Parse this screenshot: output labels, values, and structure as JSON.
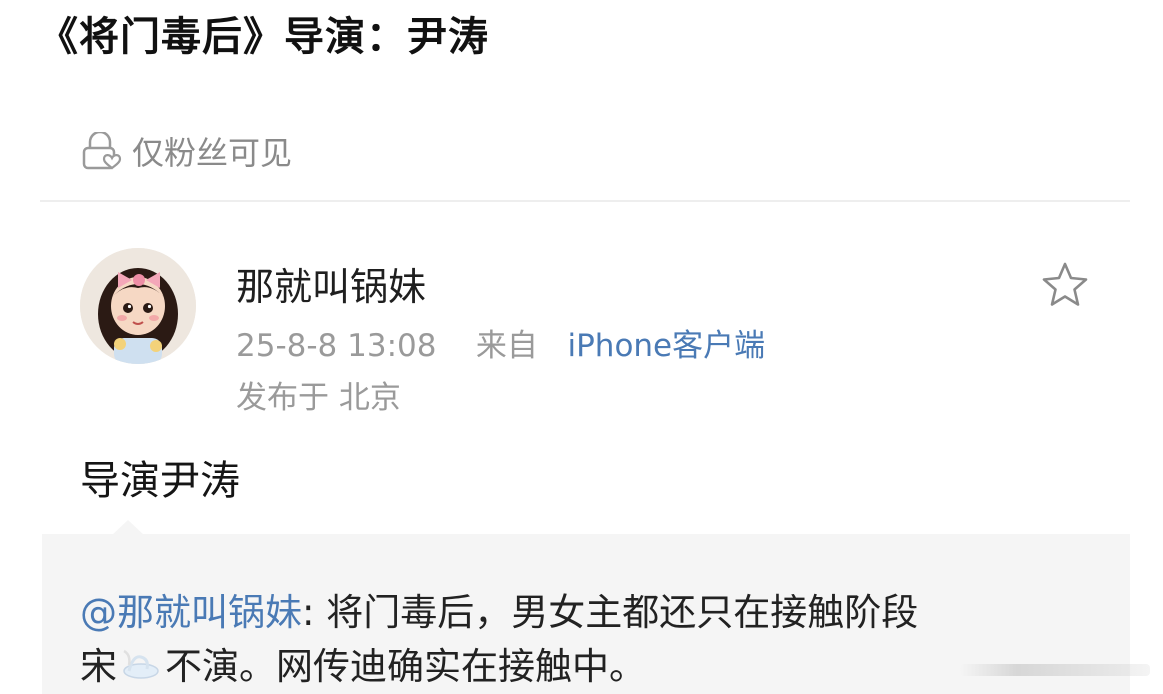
{
  "headline": "《将门毒后》导演：尹涛",
  "visibility_label": "仅粉丝可见",
  "post": {
    "username": "那就叫锅妹",
    "timestamp": "25-8-8 13:08",
    "source_prefix": "来自",
    "source": "iPhone客户端",
    "location": "发布于 北京",
    "text": "导演尹涛"
  },
  "quote": {
    "mention": "@那就叫锅妹",
    "line1_rest": ": 将门毒后，男女主都还只在接触阶段",
    "line2_before": "宋",
    "line2_after": "不演。网传迪确实在接触中。"
  },
  "icons": {
    "lock": "lock-heart-icon",
    "star": "star-outline-icon",
    "emoji": "swan-emoji-icon"
  },
  "colors": {
    "link": "#4a7ab5",
    "muted": "#9a9a9a",
    "quote_bg": "#f5f5f5"
  }
}
